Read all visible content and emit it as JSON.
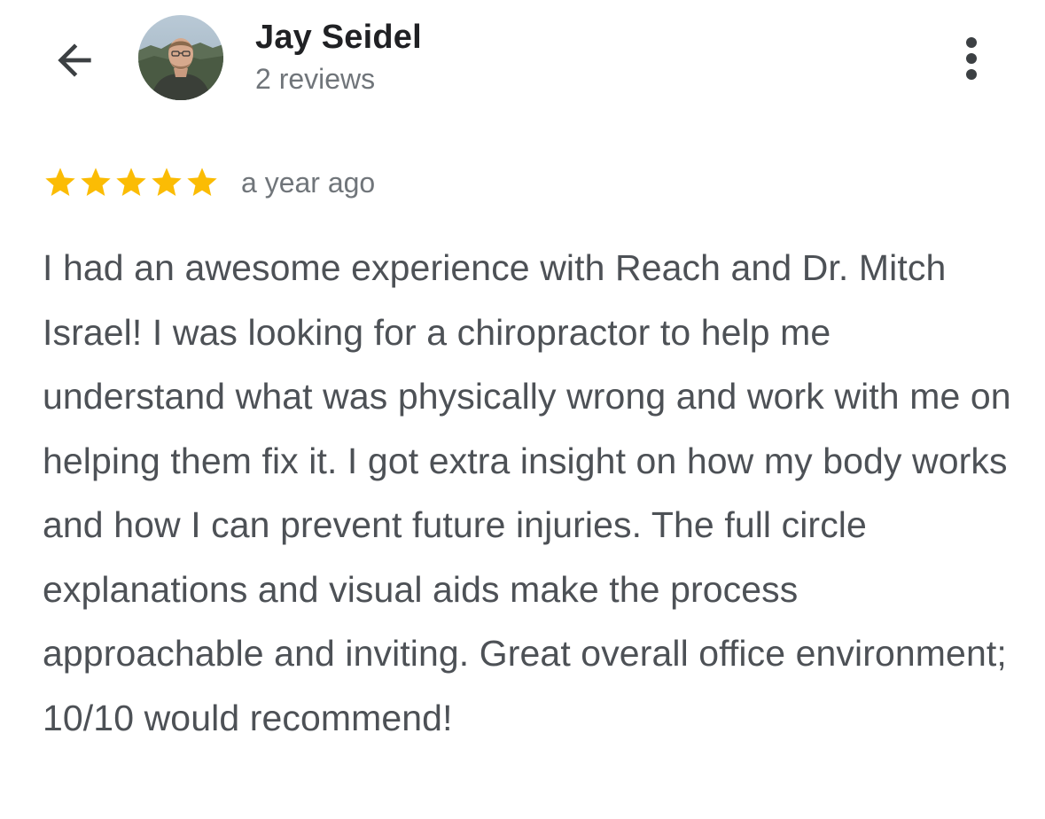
{
  "header": {
    "author_name": "Jay Seidel",
    "review_count": "2 reviews",
    "back_icon": "arrow-back-icon",
    "more_icon": "more-vert-icon"
  },
  "review": {
    "rating": 5,
    "rating_max": 5,
    "star_color": "#fbbc04",
    "time_ago": "a year ago",
    "text": "I had an awesome experience with Reach and Dr. Mitch Israel! I was looking for a chiropractor to help me understand what was physically wrong and work with me on helping them fix it. I got extra insight on how my body works and how I can prevent future injuries. The full circle explanations and visual aids make the process approachable and inviting. Great overall office environment; 10/10 would recommend!"
  }
}
